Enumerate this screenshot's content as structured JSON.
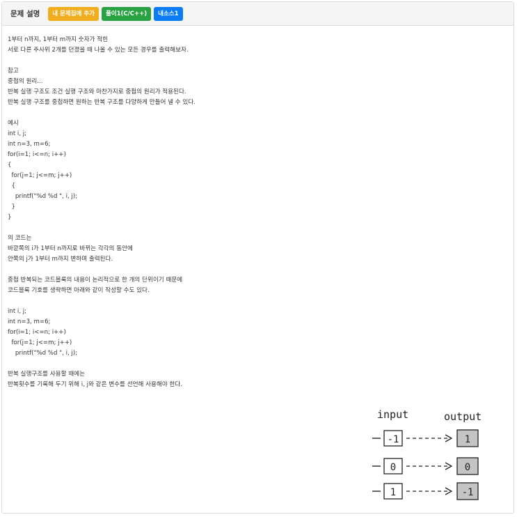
{
  "header": {
    "title": "문제 설명",
    "buttons": {
      "add_to_my_set": "내 문제집에 추가",
      "solution": "풀이1(C/C++)",
      "source": "내소스1"
    }
  },
  "content": {
    "lines": [
      "1부터 n까지, 1부터 m까지 숫자가 적힌",
      "서로 다른 주사위 2개를 던졌을 때 나올 수 있는 모든 경우를 출력해보자.",
      "",
      "참고",
      "중첩의 원리...",
      "반복 실행 구조도 조건 실행 구조와 마찬가지로 중첩의 원리가 적용된다.",
      "반복 실행 구조를 중첩하면 원하는 반복 구조를 다양하게 만들어 낼 수 있다.",
      "",
      "예시",
      "int i, j;",
      "int n=3, m=6;",
      "for(i=1; i<=n; i++)",
      "{",
      "  for(j=1; j<=m; j++)",
      "  {",
      "    printf(\"%d %d \", i, j);",
      "  }",
      "}",
      "",
      "의 코드는",
      "바깥쪽의 i가 1부터 n까지로 바뀌는 각각의 동안에",
      "안쪽의 j가 1부터 m까지 변하며 출력된다.",
      "",
      "중첩 반복되는 코드블록의 내용이 논리적으로 한 개의 단위이기 때문에",
      "코드블록 기호를 생략하면 아래와 같이 작성할 수도 있다.",
      "",
      "int i, j;",
      "int n=3, m=6;",
      "for(i=1; i<=n; i++)",
      "  for(j=1; j<=m; j++)",
      "    printf(\"%d %d \", i, j);",
      "",
      "반복 실행구조를 사용할 때에는",
      "반복횟수를 기록해 두기 위해 i, j와 같은 변수를 선언해 사용해야 한다."
    ]
  },
  "diagram": {
    "input_label": "input",
    "output_label": "output",
    "rows": [
      {
        "input": "-1",
        "output": "1"
      },
      {
        "input": "0",
        "output": "0"
      },
      {
        "input": "1",
        "output": "-1"
      }
    ]
  }
}
